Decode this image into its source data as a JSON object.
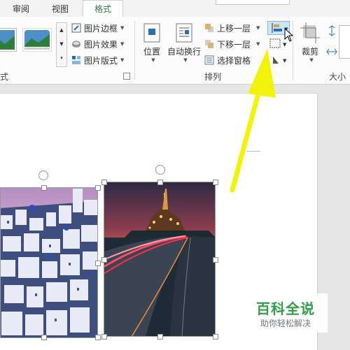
{
  "tabs": {
    "review": "审阅",
    "view": "视图",
    "format": "格式"
  },
  "picture_styles": {
    "border": "图片边框",
    "effects": "图片效果",
    "layout": "图片版式",
    "group_label_tail": "式"
  },
  "arrange": {
    "position": "位置",
    "wrap_text": "自动换行",
    "bring_forward": "上移一层",
    "send_backward": "下移一层",
    "selection_pane": "选择窗格",
    "group_label": "排列"
  },
  "size": {
    "crop": "裁剪",
    "group_label": "大小"
  },
  "colors": {
    "format_tab": "#2b7a3f",
    "arrow": "#f2f20a",
    "hover": "#cce4f7"
  },
  "watermark": {
    "title": "百科全说",
    "subtitle": "助你轻松解决"
  }
}
